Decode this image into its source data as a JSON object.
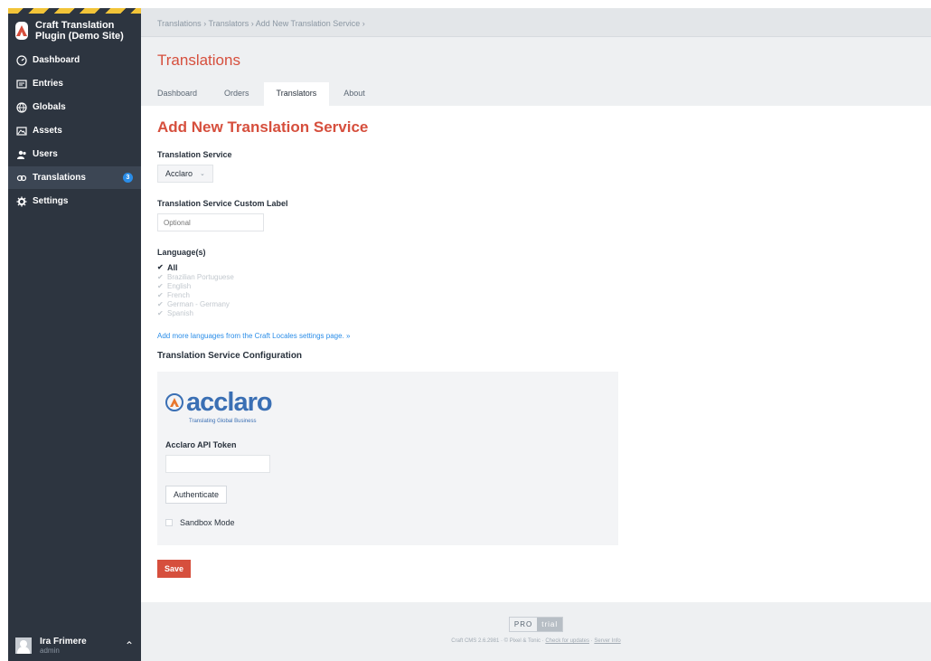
{
  "sidebar": {
    "site_name": "Craft Translation Plugin (Demo Site)",
    "items": [
      {
        "label": "Dashboard",
        "icon": "dashboard-icon"
      },
      {
        "label": "Entries",
        "icon": "entries-icon"
      },
      {
        "label": "Globals",
        "icon": "globe-icon"
      },
      {
        "label": "Assets",
        "icon": "assets-icon"
      },
      {
        "label": "Users",
        "icon": "users-icon"
      },
      {
        "label": "Translations",
        "icon": "translations-icon",
        "badge": "3"
      },
      {
        "label": "Settings",
        "icon": "gear-icon"
      }
    ],
    "user": {
      "name": "Ira Frimere",
      "role": "admin"
    }
  },
  "breadcrumb": "Translations › Translators › Add New Translation Service ›",
  "header": {
    "title": "Translations"
  },
  "tabs": [
    "Dashboard",
    "Orders",
    "Translators",
    "About"
  ],
  "form": {
    "title": "Add New Translation Service",
    "service_label": "Translation Service",
    "service_value": "Acclaro",
    "custom_label": "Translation Service Custom Label",
    "custom_placeholder": "Optional",
    "languages_label": "Language(s)",
    "languages": [
      "All",
      "Brazilian Portuguese",
      "English",
      "French",
      "German - Germany",
      "Spanish"
    ],
    "locales_link": "Add more languages from the Craft Locales settings page. »",
    "config_title": "Translation Service Configuration",
    "logo_word": "acclaro",
    "logo_tagline": "Translating Global Business",
    "api_token_label": "Acclaro API Token",
    "authenticate_label": "Authenticate",
    "sandbox_label": "Sandbox Mode",
    "save_label": "Save"
  },
  "footer": {
    "edition": "PRO",
    "edition_status": "trial",
    "version_text": "Craft CMS 2.6.2981 · © Pixel & Tonic ·",
    "updates_link": "Check for updates",
    "server_link": "Server Info"
  },
  "colors": {
    "accent": "#d64f3d",
    "sidebar": "#2d3540",
    "link": "#2a8de8"
  }
}
